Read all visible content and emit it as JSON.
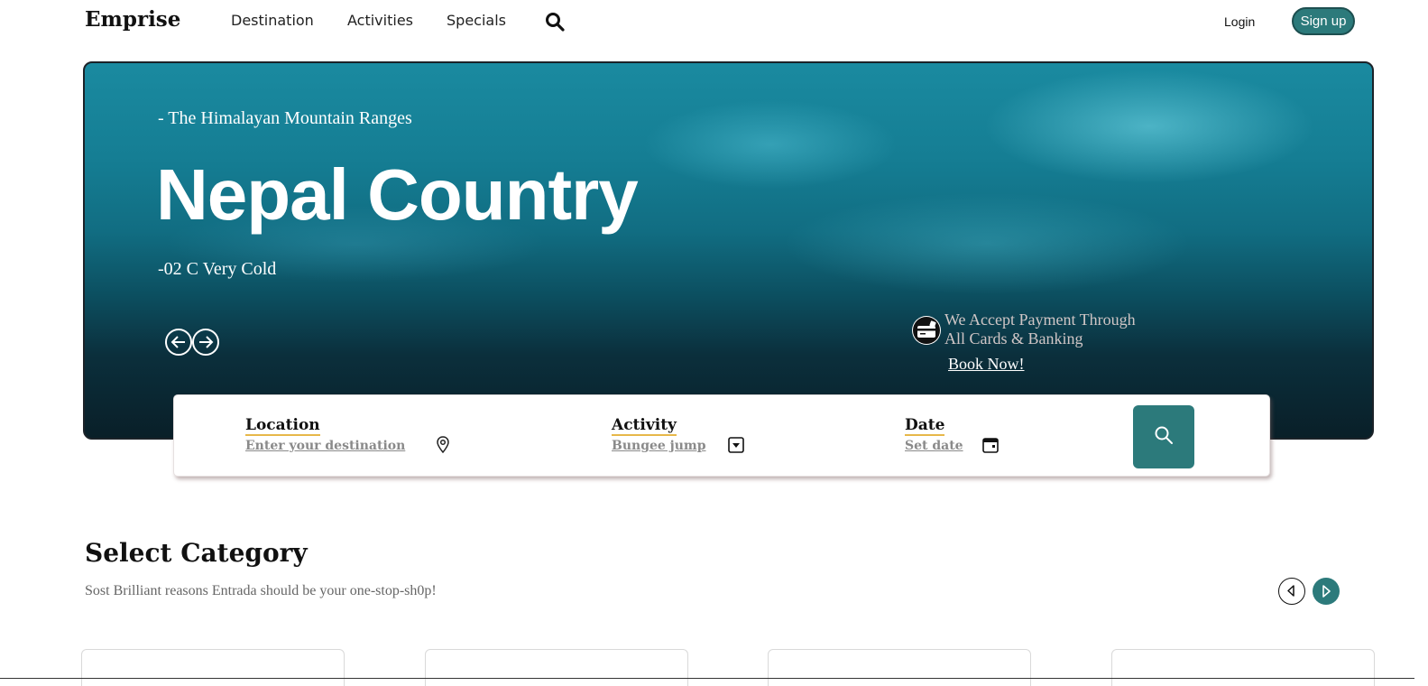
{
  "nav": {
    "brand": "Emprise",
    "links": [
      "Destination",
      "Activities",
      "Specials"
    ],
    "search_icon": "search-icon",
    "login_label": "Login",
    "signup_label": "Sign up"
  },
  "hero": {
    "subtitle": "- The Himalayan Mountain Ranges",
    "title": "Nepal Country",
    "temperature": "-02 C Very Cold",
    "prev_icon": "arrow-left-icon",
    "next_icon": "arrow-right-icon",
    "payment_icon": "credit-card-icon",
    "payment_line1": "We Accept Payment Through",
    "payment_line2": "All Cards & Banking",
    "book_now": "Book Now!"
  },
  "search": {
    "location_label": "Location",
    "location_placeholder": "Enter your destination",
    "location_icon": "map-pin-icon",
    "activity_label": "Activity",
    "activity_value": "Bungee jump",
    "activity_icon": "dropdown-icon",
    "date_label": "Date",
    "date_placeholder": "Set date",
    "date_icon": "calendar-icon",
    "button_icon": "search-icon"
  },
  "category": {
    "title": "Select Category",
    "subtitle": "Sost Brilliant reasons Entrada should be your one-stop-sh0p!",
    "prev_icon": "chevron-left-icon",
    "next_icon": "chevron-right-icon"
  },
  "colors": {
    "accent": "#2c7a7b",
    "label_underline": "#e7b84a",
    "muted_text": "#8a8a8a"
  }
}
